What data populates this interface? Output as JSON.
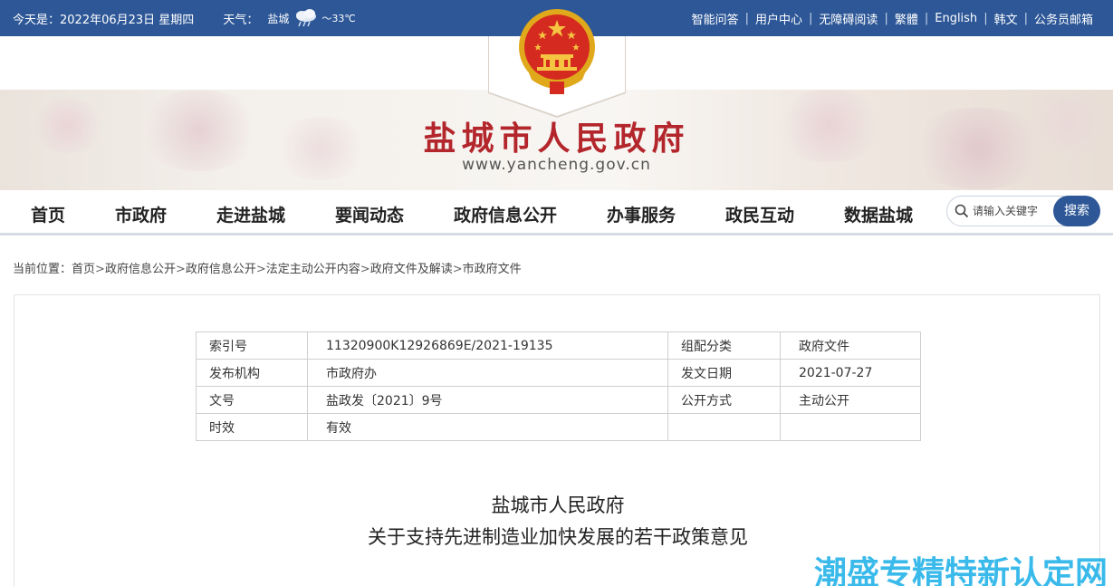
{
  "topbar": {
    "date_text": "今天是：2022年06月23日 星期四",
    "weather_label": "天气：",
    "weather_city": "盐城",
    "weather_temp": "～33℃",
    "links": [
      "智能问答",
      "用户中心",
      "无障碍阅读",
      "繁體",
      "English",
      "韩文",
      "公务员邮箱"
    ],
    "separator": "|"
  },
  "header": {
    "title": "盐城市人民政府",
    "domain": "www.yancheng.gov.cn"
  },
  "nav": {
    "items": [
      "首页",
      "市政府",
      "走进盐城",
      "要闻动态",
      "政府信息公开",
      "办事服务",
      "政民互动",
      "数据盐城"
    ],
    "search_placeholder": "请输入关键字",
    "search_button": "搜索"
  },
  "breadcrumb": {
    "prefix": "当前位置：",
    "items": [
      "首页",
      "政府信息公开",
      "政府信息公开",
      "法定主动公开内容",
      "政府文件及解读",
      "市政府文件"
    ],
    "separator": ">"
  },
  "meta_table": {
    "rows": [
      {
        "k1": "索引号",
        "v1": "11320900K12926869E/2021-19135",
        "k2": "组配分类",
        "v2": "政府文件"
      },
      {
        "k1": "发布机构",
        "v1": "市政府办",
        "k2": "发文日期",
        "v2": "2021-07-27"
      },
      {
        "k1": "文号",
        "v1": "盐政发〔2021〕9号",
        "k2": "公开方式",
        "v2": "主动公开"
      },
      {
        "k1": "时效",
        "v1": "有效"
      }
    ]
  },
  "document": {
    "title_line1": "盐城市人民政府",
    "title_line2": "关于支持先进制造业加快发展的若干政策意见"
  },
  "watermark": {
    "text": "潮盛专精特新认定网"
  },
  "colors": {
    "topbar_bg": "#2d5797",
    "title_red": "#b3262c",
    "watermark_blue": "#25b3e8"
  }
}
